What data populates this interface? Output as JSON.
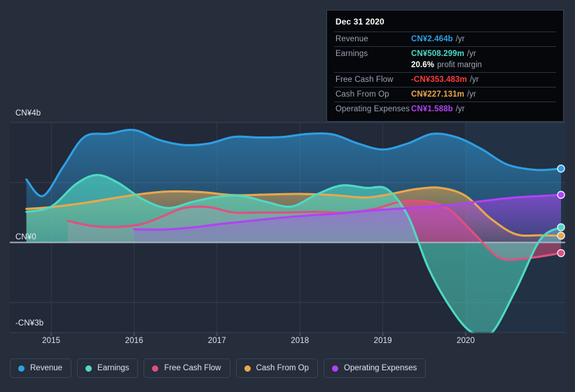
{
  "colors": {
    "background": "#262d3b",
    "plot_background": "#222938",
    "revenue": "#2f9fe3",
    "earnings": "#4fd9c4",
    "free_cash_flow": "#e0507f",
    "cash_from_op": "#e8a84c",
    "operating_expenses": "#b042f5",
    "grid": "#39414f",
    "zero_line": "#b9bfcb",
    "tooltip_bg": "#05070b",
    "tooltip_border": "#3a4456",
    "negative_value": "#ff3b3b"
  },
  "tooltip": {
    "title": "Dec 31 2020",
    "rows": [
      {
        "key": "Revenue",
        "value": "CN¥2.464b",
        "suffix": "/yr",
        "color": "#2f9fe3"
      },
      {
        "key": "Earnings",
        "value": "CN¥508.299m",
        "suffix": "/yr",
        "color": "#4fd9c4"
      },
      {
        "key": "",
        "value": "20.6%",
        "suffix": "profit margin",
        "color": "#ffffff"
      },
      {
        "key": "Free Cash Flow",
        "value": "-CN¥353.483m",
        "suffix": "/yr",
        "color": "#ff3b3b"
      },
      {
        "key": "Cash From Op",
        "value": "CN¥227.131m",
        "suffix": "/yr",
        "color": "#e8a84c"
      },
      {
        "key": "Operating Expenses",
        "value": "CN¥1.588b",
        "suffix": "/yr",
        "color": "#b042f5"
      }
    ]
  },
  "legend": {
    "items": [
      {
        "label": "Revenue",
        "color": "#2f9fe3"
      },
      {
        "label": "Earnings",
        "color": "#4fd9c4"
      },
      {
        "label": "Free Cash Flow",
        "color": "#e0507f"
      },
      {
        "label": "Cash From Op",
        "color": "#e8a84c"
      },
      {
        "label": "Operating Expenses",
        "color": "#b042f5"
      }
    ]
  },
  "chart_data": {
    "type": "area",
    "title": "",
    "xlabel": "",
    "ylabel": "",
    "currency": "CN¥",
    "units": "billions",
    "grid": true,
    "legend_position": "bottom",
    "xlim": [
      2014.5,
      2021.2
    ],
    "ylim": [
      -3.0,
      4.0
    ],
    "x_tick_labels": [
      "2015",
      "2016",
      "2017",
      "2018",
      "2019",
      "2020"
    ],
    "x_ticks": [
      2015,
      2016,
      2017,
      2018,
      2019,
      2020
    ],
    "y_tick_labels": [
      "CN¥4b",
      "CN¥0",
      "-CN¥3b"
    ],
    "y_ticks": [
      4.0,
      0.0,
      -3.0
    ],
    "y_gridlines": [
      4.0,
      2.0,
      0.0,
      -2.0,
      -3.0
    ],
    "zero_line": 0.0,
    "forecast_region_start": 2020.0,
    "series": [
      {
        "name": "Revenue",
        "color": "#2f9fe3",
        "x": [
          2014.7,
          2014.9,
          2015.15,
          2015.4,
          2015.7,
          2016.0,
          2016.3,
          2016.6,
          2016.9,
          2017.2,
          2017.5,
          2017.8,
          2018.1,
          2018.4,
          2018.7,
          2019.0,
          2019.3,
          2019.6,
          2019.9,
          2020.2,
          2020.5,
          2020.85,
          2021.15
        ],
        "values": [
          2.1,
          1.55,
          2.55,
          3.52,
          3.63,
          3.75,
          3.42,
          3.25,
          3.3,
          3.52,
          3.5,
          3.52,
          3.62,
          3.6,
          3.3,
          3.1,
          3.3,
          3.62,
          3.5,
          3.1,
          2.6,
          2.42,
          2.464
        ],
        "end_value": 2.464,
        "end_label": "CN¥2.464b"
      },
      {
        "name": "Earnings",
        "color": "#4fd9c4",
        "x": [
          2014.7,
          2015.0,
          2015.3,
          2015.55,
          2015.8,
          2016.1,
          2016.4,
          2016.7,
          2017.0,
          2017.3,
          2017.6,
          2017.9,
          2018.2,
          2018.5,
          2018.8,
          2019.05,
          2019.3,
          2019.55,
          2019.8,
          2020.05,
          2020.3,
          2020.6,
          2020.9,
          2021.15
        ],
        "values": [
          1.02,
          1.2,
          1.95,
          2.25,
          2.0,
          1.45,
          1.15,
          1.35,
          1.52,
          1.55,
          1.35,
          1.2,
          1.6,
          1.9,
          1.82,
          1.78,
          0.9,
          -0.85,
          -2.1,
          -2.95,
          -3.05,
          -1.6,
          0.1,
          0.508
        ],
        "end_value": 0.508,
        "end_label": "CN¥508.299m"
      },
      {
        "name": "Free Cash Flow",
        "color": "#e0507f",
        "x": [
          2015.2,
          2015.5,
          2015.8,
          2016.1,
          2016.35,
          2016.6,
          2016.9,
          2017.2,
          2017.5,
          2017.85,
          2018.2,
          2018.55,
          2018.9,
          2019.2,
          2019.5,
          2019.8,
          2020.1,
          2020.4,
          2020.7,
          2021.15
        ],
        "values": [
          0.72,
          0.55,
          0.52,
          0.62,
          0.88,
          1.15,
          1.18,
          1.0,
          1.0,
          1.0,
          1.02,
          1.0,
          1.12,
          1.35,
          1.38,
          1.1,
          0.3,
          -0.5,
          -0.54,
          -0.353
        ],
        "end_value": -0.353,
        "end_label": "-CN¥353.483m"
      },
      {
        "name": "Cash From Op",
        "color": "#e8a84c",
        "x": [
          2014.7,
          2015.0,
          2015.4,
          2015.8,
          2016.1,
          2016.4,
          2016.8,
          2017.2,
          2017.6,
          2018.0,
          2018.4,
          2018.8,
          2019.1,
          2019.4,
          2019.7,
          2020.0,
          2020.3,
          2020.6,
          2020.9,
          2021.15
        ],
        "values": [
          1.12,
          1.18,
          1.32,
          1.5,
          1.62,
          1.7,
          1.68,
          1.58,
          1.6,
          1.62,
          1.58,
          1.5,
          1.62,
          1.78,
          1.82,
          1.55,
          0.8,
          0.28,
          0.24,
          0.227
        ],
        "end_value": 0.227,
        "end_label": "CN¥227.131m"
      },
      {
        "name": "Operating Expenses",
        "color": "#b042f5",
        "x": [
          2016.0,
          2016.35,
          2016.7,
          2017.05,
          2017.4,
          2017.75,
          2018.1,
          2018.45,
          2018.8,
          2019.15,
          2019.5,
          2019.85,
          2020.2,
          2020.6,
          2021.15
        ],
        "values": [
          0.44,
          0.43,
          0.5,
          0.62,
          0.72,
          0.82,
          0.9,
          0.96,
          1.05,
          1.12,
          1.18,
          1.26,
          1.38,
          1.5,
          1.588
        ],
        "end_value": 1.588,
        "end_label": "CN¥1.588b"
      }
    ]
  }
}
